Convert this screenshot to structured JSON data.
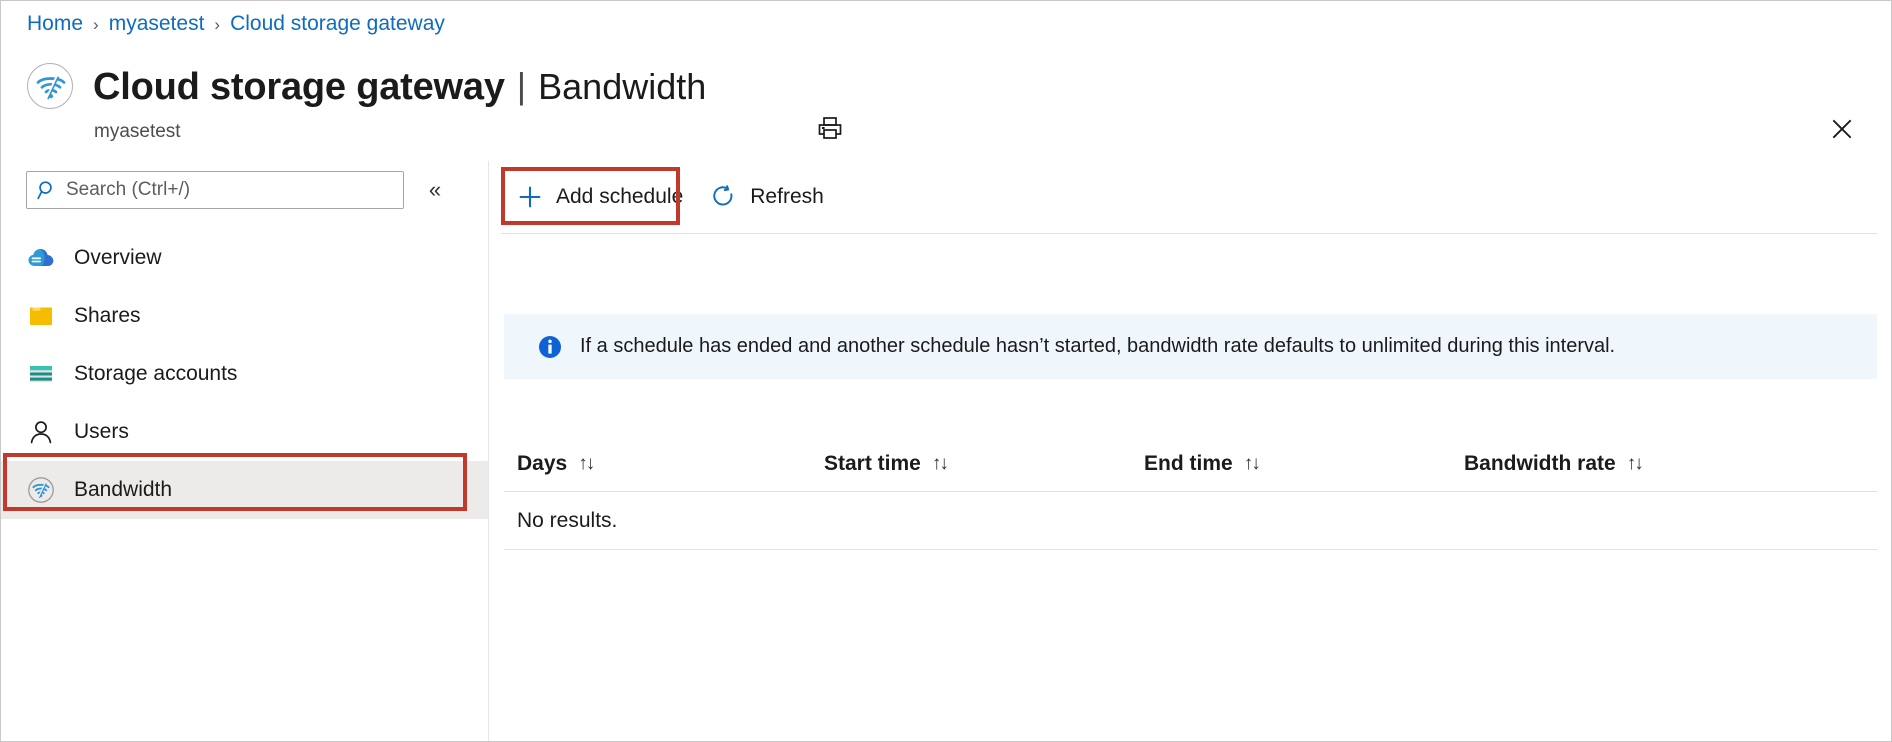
{
  "breadcrumb": {
    "items": [
      {
        "label": "Home"
      },
      {
        "label": "myasetest"
      },
      {
        "label": "Cloud storage gateway"
      }
    ],
    "separator": "›"
  },
  "header": {
    "resource_icon": "cloud-storage-gateway-icon",
    "title_main": "Cloud storage gateway",
    "title_separator": "|",
    "title_sub": "Bandwidth",
    "subtitle": "myasetest",
    "print_icon": "print-icon",
    "close_icon": "close-icon"
  },
  "sidebar": {
    "search": {
      "placeholder": "Search (Ctrl+/)",
      "value": "",
      "icon": "search-icon"
    },
    "collapse_icon": "«",
    "items": [
      {
        "label": "Overview",
        "icon": "cloud-icon",
        "selected": false
      },
      {
        "label": "Shares",
        "icon": "folder-icon",
        "selected": false
      },
      {
        "label": "Storage accounts",
        "icon": "storage-account-icon",
        "selected": false
      },
      {
        "label": "Users",
        "icon": "user-icon",
        "selected": false
      },
      {
        "label": "Bandwidth",
        "icon": "bandwidth-icon",
        "selected": true
      }
    ]
  },
  "toolbar": {
    "add_schedule_label": "Add schedule",
    "add_schedule_icon": "plus-icon",
    "refresh_label": "Refresh",
    "refresh_icon": "refresh-icon"
  },
  "info_banner": {
    "icon": "info-icon",
    "text": "If a schedule has ended and another schedule hasn’t started, bandwidth rate defaults to unlimited during this interval."
  },
  "table": {
    "columns": [
      {
        "label": "Days",
        "sort_icon": "↑↓"
      },
      {
        "label": "Start time",
        "sort_icon": "↑↓"
      },
      {
        "label": "End time",
        "sort_icon": "↑↓"
      },
      {
        "label": "Bandwidth rate",
        "sort_icon": "↑↓"
      }
    ],
    "empty_message": "No results.",
    "rows": []
  },
  "annotations": {
    "add_schedule_highlight": "red-rectangle",
    "bandwidth_nav_highlight": "red-rectangle"
  },
  "colors": {
    "link": "#0f6cbd",
    "accent": "#0078d4",
    "annotation": "#c0392b",
    "info_bg": "#eff6fc",
    "selected_nav_bg": "#edebe9"
  }
}
